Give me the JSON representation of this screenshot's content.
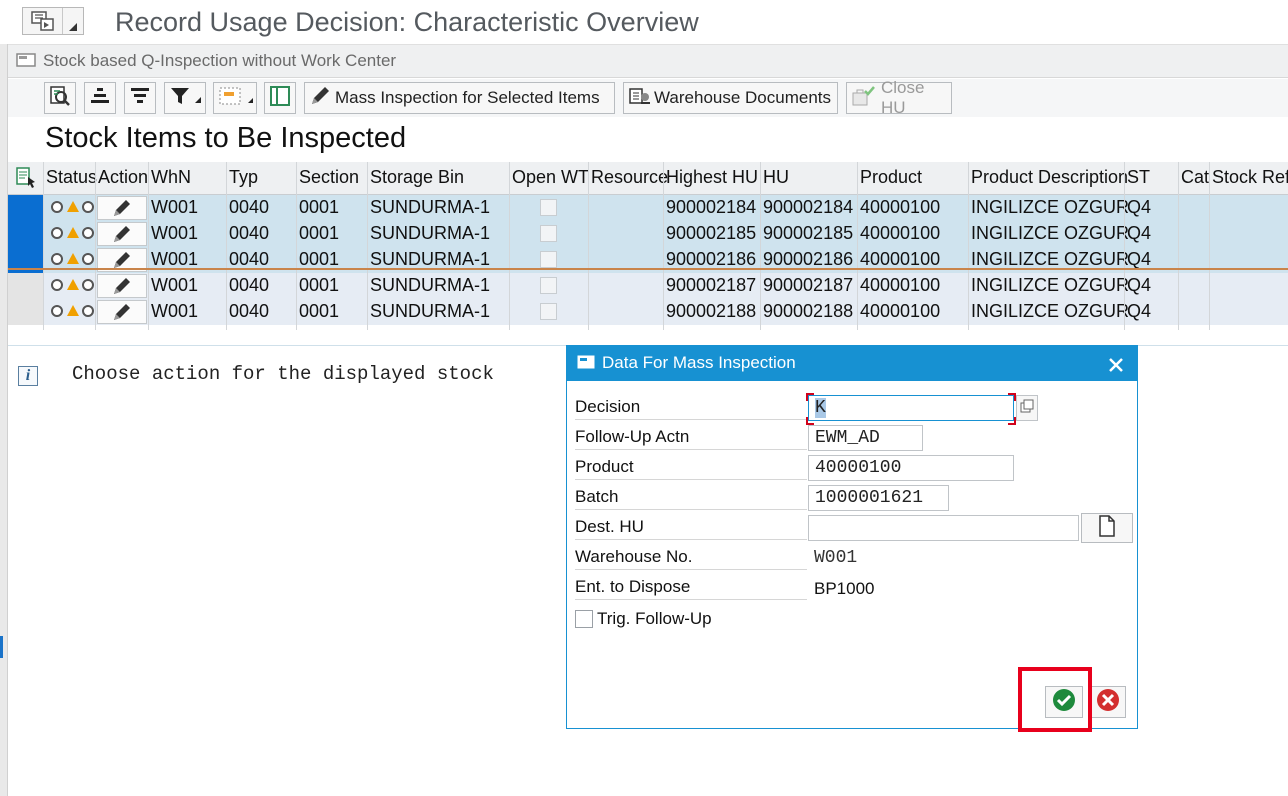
{
  "window": {
    "title": "Record Usage Decision: Characteristic Overview"
  },
  "subheader": {
    "text": "Stock based Q-Inspection without Work Center"
  },
  "toolbar": {
    "mass_inspection_label": "Mass Inspection for Selected Items",
    "warehouse_docs_label": "Warehouse Documents",
    "close_hu_label": "Close HU",
    "icons": [
      "details-icon",
      "sort-ascending-icon",
      "sort-descending-icon",
      "filter-icon",
      "layout-icon",
      "column-icon"
    ]
  },
  "section": {
    "title": "Stock Items to Be Inspected"
  },
  "table": {
    "columns": [
      "Status",
      "Action",
      "WhN",
      "Typ",
      "Section",
      "Storage Bin",
      "Open WT",
      "Resource",
      "Highest HU",
      "HU",
      "Product",
      "Product Description",
      "ST",
      "Cat",
      "Stock Ref"
    ],
    "rows": [
      {
        "whn": "W001",
        "typ": "0040",
        "section": "0001",
        "bin": "SUNDURMA-1",
        "highest_hu": "900002184",
        "hu": "900002184",
        "product": "40000100",
        "desc": "INGILIZCE OZGUR",
        "st": "Q4",
        "selected": true
      },
      {
        "whn": "W001",
        "typ": "0040",
        "section": "0001",
        "bin": "SUNDURMA-1",
        "highest_hu": "900002185",
        "hu": "900002185",
        "product": "40000100",
        "desc": "INGILIZCE OZGUR",
        "st": "Q4",
        "selected": true
      },
      {
        "whn": "W001",
        "typ": "0040",
        "section": "0001",
        "bin": "SUNDURMA-1",
        "highest_hu": "900002186",
        "hu": "900002186",
        "product": "40000100",
        "desc": "INGILIZCE OZGUR",
        "st": "Q4",
        "selected": true
      },
      {
        "whn": "W001",
        "typ": "0040",
        "section": "0001",
        "bin": "SUNDURMA-1",
        "highest_hu": "900002187",
        "hu": "900002187",
        "product": "40000100",
        "desc": "INGILIZCE OZGUR",
        "st": "Q4",
        "selected": false
      },
      {
        "whn": "W001",
        "typ": "0040",
        "section": "0001",
        "bin": "SUNDURMA-1",
        "highest_hu": "900002188",
        "hu": "900002188",
        "product": "40000100",
        "desc": "INGILIZCE OZGUR",
        "st": "Q4",
        "selected": false
      }
    ]
  },
  "message": {
    "text": "Choose action for the displayed stock"
  },
  "dialog": {
    "title": "Data For Mass Inspection",
    "fields": {
      "decision": {
        "label": "Decision",
        "value": "K"
      },
      "followup": {
        "label": "Follow-Up Actn",
        "value": "EWM_AD"
      },
      "product": {
        "label": "Product",
        "value": "40000100"
      },
      "batch": {
        "label": "Batch",
        "value": "1000001621"
      },
      "dest_hu": {
        "label": "Dest. HU",
        "value": ""
      },
      "warehouse": {
        "label": "Warehouse No.",
        "value": "W001"
      },
      "ent_dispose": {
        "label": "Ent. to Dispose",
        "value": "BP1000"
      },
      "trig_followup": {
        "label": "Trig. Follow-Up",
        "checked": false
      }
    }
  },
  "colors": {
    "accent": "#1791d2",
    "selected_row": "#cfe3ee",
    "row_select_marker": "#0a6ed1",
    "highlight": "#e8001c"
  }
}
